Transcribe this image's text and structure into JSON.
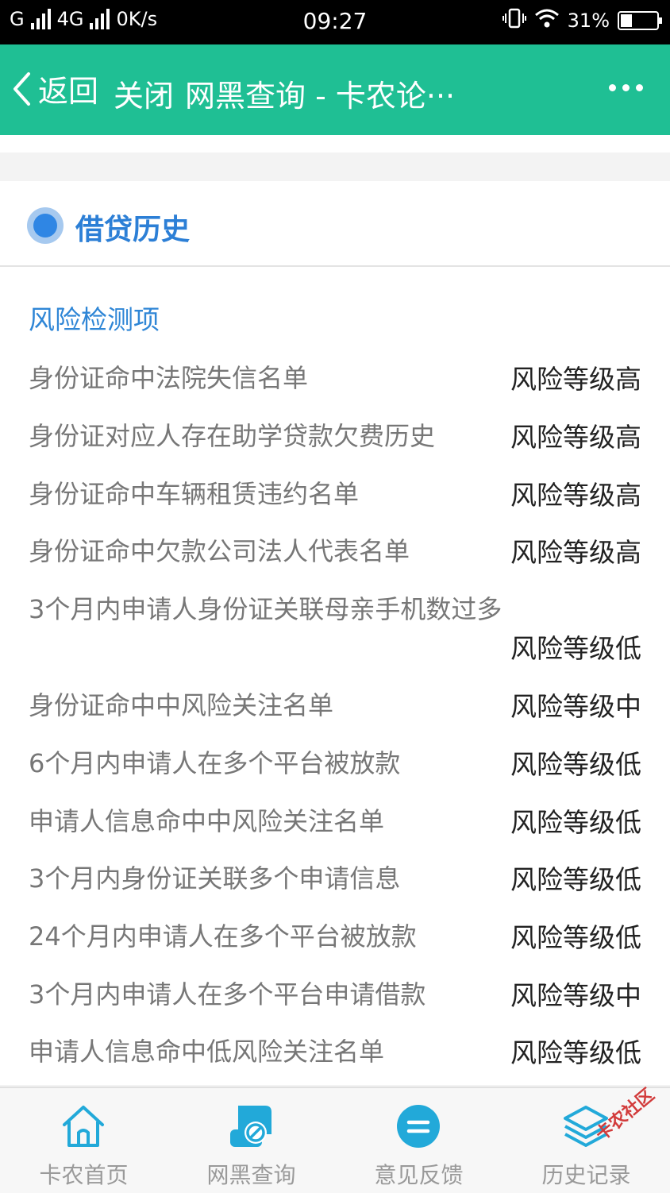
{
  "status_bar": {
    "carrier_1": "G",
    "carrier_2": "4G",
    "speed": "0K/s",
    "time": "09:27",
    "battery_text": "31%",
    "battery_level": 0.31
  },
  "titlebar": {
    "back_label": "返回",
    "close_label": "关闭",
    "title": "网黑查询 - 卡农论···",
    "more_icon": "more-dots-icon",
    "background": "#1fbf94"
  },
  "card": {
    "title": "借贷历史",
    "section_title": "风险检测项"
  },
  "risk_items": [
    {
      "name": "身份证命中法院失信名单",
      "level": "风险等级高"
    },
    {
      "name": "身份证对应人存在助学贷款欠费历史",
      "level": "风险等级高"
    },
    {
      "name": "身份证命中车辆租赁违约名单",
      "level": "风险等级高"
    },
    {
      "name": "身份证命中欠款公司法人代表名单",
      "level": "风险等级高"
    },
    {
      "name": "3个月内申请人身份证关联母亲手机数过多",
      "level": "风险等级低"
    },
    {
      "name": "身份证命中中风险关注名单",
      "level": "风险等级中"
    },
    {
      "name": "6个月内申请人在多个平台被放款",
      "level": "风险等级低"
    },
    {
      "name": "申请人信息命中中风险关注名单",
      "level": "风险等级低"
    },
    {
      "name": "3个月内身份证关联多个申请信息",
      "level": "风险等级低"
    },
    {
      "name": "24个月内申请人在多个平台被放款",
      "level": "风险等级低"
    },
    {
      "name": "3个月内申请人在多个平台申请借款",
      "level": "风险等级中"
    },
    {
      "name": "申请人信息命中低风险关注名单",
      "level": "风险等级低"
    }
  ],
  "bottom_nav": [
    {
      "label": "卡农首页",
      "icon": "home-icon"
    },
    {
      "label": "网黑查询",
      "icon": "blacklist-query-icon"
    },
    {
      "label": "意见反馈",
      "icon": "feedback-icon"
    },
    {
      "label": "历史记录",
      "icon": "history-layers-icon"
    }
  ],
  "watermark": "卡农社区",
  "colors": {
    "accent_blue": "#2f86e4",
    "icon_cyan": "#22a9d9"
  }
}
